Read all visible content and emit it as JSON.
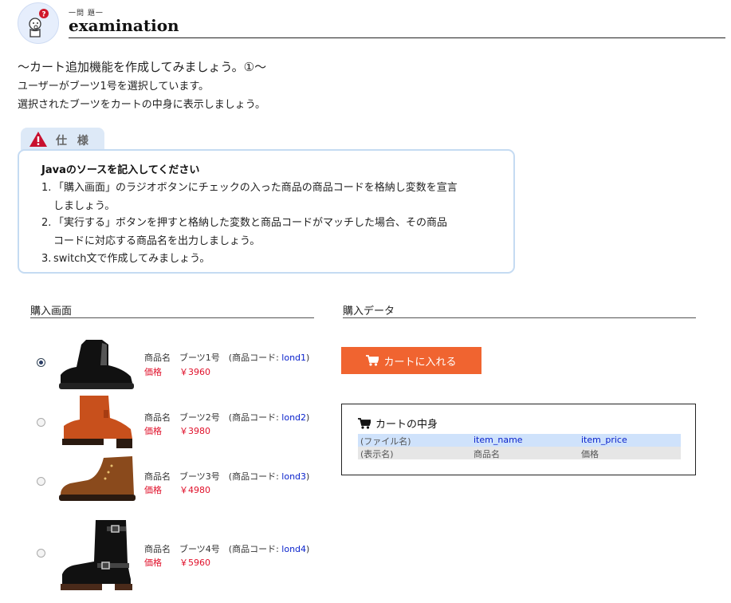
{
  "header": {
    "small_label": "一問 題一",
    "title": "examination"
  },
  "intro": {
    "heading": "〜カート追加機能を作成してみましょう。①〜",
    "lines": [
      "ユーザーがブーツ1号を選択しています。",
      "選択されたブーツをカートの中身に表示しましょう。"
    ]
  },
  "spec": {
    "tab_label": "仕 様",
    "heading": "Javaのソースを記入してください",
    "items": [
      {
        "num": "1.",
        "line1": "「購入画面」のラジオボタンにチェックの入った商品の商品コードを格納し変数を宣言",
        "line2": "しましょう。"
      },
      {
        "num": "2.",
        "line1": "「実行する」ボタンを押すと格納した変数と商品コードがマッチした場合、その商品",
        "line2": "コードに対応する商品名を出力しましょう。"
      },
      {
        "num": "3.",
        "line1": "switch文で作成してみましょう。"
      }
    ]
  },
  "purchase_screen": {
    "title": "購入画面",
    "name_label": "商品名",
    "code_prefix": "(商品コード: ",
    "code_suffix": ")",
    "price_label": "価格",
    "products": [
      {
        "name": "ブーツ1号",
        "code": "lond1",
        "price": "￥3960",
        "selected": true,
        "color": "#111111"
      },
      {
        "name": "ブーツ2号",
        "code": "lond2",
        "price": "￥3980",
        "selected": false,
        "color": "#c8501c"
      },
      {
        "name": "ブーツ3号",
        "code": "lond3",
        "price": "￥4980",
        "selected": false,
        "color": "#8a4a1c"
      },
      {
        "name": "ブーツ4号",
        "code": "lond4",
        "price": "￥5960",
        "selected": false,
        "color": "#111111"
      }
    ]
  },
  "purchase_data": {
    "title": "購入データ",
    "cart_button_label": "カートに入れる",
    "cart_button_icon": "cart-icon",
    "button_color": "#f06430",
    "cart": {
      "title": "カートの中身",
      "row1": [
        "(ファイル名)",
        "item_name",
        "item_price"
      ],
      "row2": [
        "(表示名)",
        "商品名",
        "価格"
      ]
    }
  }
}
